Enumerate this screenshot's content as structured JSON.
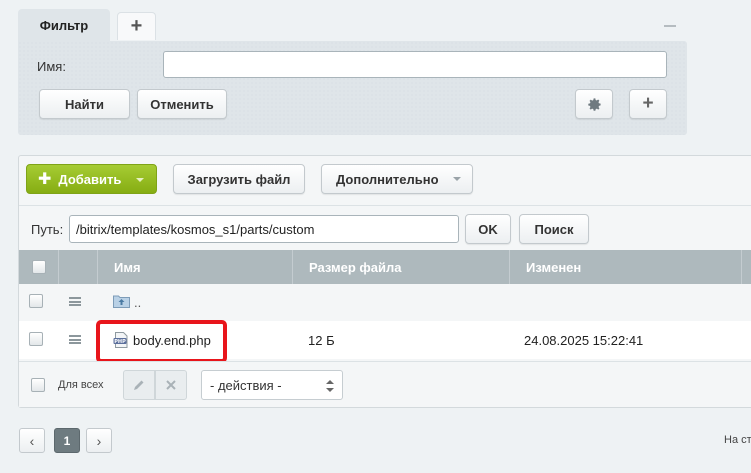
{
  "filter": {
    "tab_label": "Фильтр",
    "add_tab_label": "+",
    "name_label": "Имя:",
    "name_value": "",
    "find_label": "Найти",
    "cancel_label": "Отменить",
    "add_label": "+"
  },
  "toolbar": {
    "add_label": "Добавить",
    "upload_label": "Загрузить файл",
    "more_label": "Дополнительно"
  },
  "path": {
    "label": "Путь:",
    "value": "/bitrix/templates/kosmos_s1/parts/custom",
    "ok_label": "OK",
    "search_label": "Поиск"
  },
  "table": {
    "columns": [
      "Имя",
      "Размер файла",
      "Изменен"
    ],
    "rows": [
      {
        "name": "..",
        "size": "",
        "modified": "",
        "icon": "folder-up-icon"
      },
      {
        "name": "body.end.php",
        "size": "12 Б",
        "modified": "24.08.2025 15:22:41",
        "icon": "php-file-icon"
      }
    ]
  },
  "footer": {
    "for_all_label": "Для всех",
    "actions_value": "- действия -"
  },
  "pagination": {
    "prev": "‹",
    "current": "1",
    "next": "›",
    "note": "На ст"
  },
  "colors": {
    "accent_green": "#95bc1f",
    "highlight_red": "#e8151b",
    "header_gray": "#aeb9bd"
  }
}
